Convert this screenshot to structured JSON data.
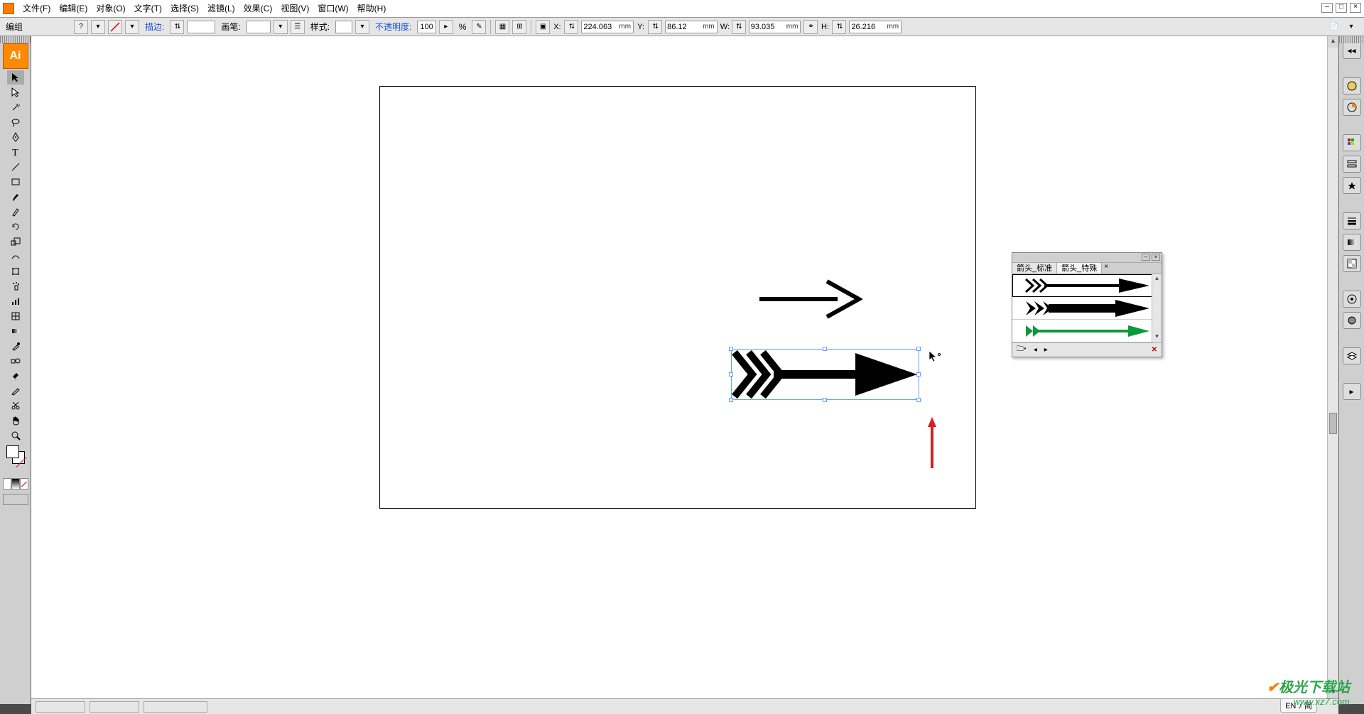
{
  "menubar": {
    "items": [
      "文件(F)",
      "编辑(E)",
      "对象(O)",
      "文字(T)",
      "选择(S)",
      "滤镜(L)",
      "效果(C)",
      "视图(V)",
      "窗口(W)",
      "帮助(H)"
    ]
  },
  "optbar": {
    "selection_label": "编组",
    "stroke_label": "描边:",
    "brush_label": "画笔:",
    "style_label": "样式:",
    "opacity_label": "不透明度:",
    "opacity_value": "100",
    "opacity_pct": "%",
    "X_label": "X:",
    "Y_label": "Y:",
    "W_label": "W:",
    "H_label": "H:",
    "X_value": "224.063",
    "Y_value": "86.12",
    "W_value": "93.035",
    "H_value": "26.216",
    "unit": "mm"
  },
  "left_tools": [
    "selection",
    "direct-selection",
    "magic-wand",
    "lasso",
    "pen",
    "type",
    "line",
    "rectangle",
    "paintbrush",
    "pencil",
    "rotate",
    "scale",
    "warp",
    "free-transform",
    "symbol-sprayer",
    "graph",
    "mesh",
    "gradient",
    "eyedropper",
    "blend",
    "live-paint",
    "slice",
    "scissors",
    "hand",
    "zoom"
  ],
  "right_dock_panels": [
    "tools-toggle",
    "color",
    "color-guide",
    "swatches",
    "stroke",
    "gradient",
    "transparency",
    "appearance",
    "graphic-styles",
    "layers",
    "symbols",
    "brushes",
    "align"
  ],
  "brush_panel": {
    "tab1": "箭头_标准",
    "tab2": "箭头_特殊",
    "close": "×",
    "footer_delete": "✕",
    "rows": [
      "fletched-arrow-outline",
      "fletched-arrow-solid",
      "green-arrow"
    ]
  },
  "statusbar": {
    "ime": "EN ♪ 简"
  },
  "watermark": {
    "line1_a": "极光",
    "line1_b": "下载站",
    "line2": "www.xz7.com"
  }
}
